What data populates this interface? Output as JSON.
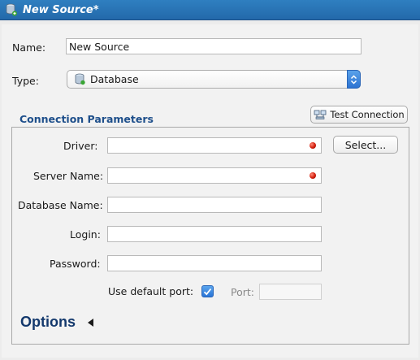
{
  "window": {
    "title": "New Source*",
    "icon": "database-icon"
  },
  "form": {
    "name_label": "Name:",
    "name_value": "New Source",
    "type_label": "Type:",
    "type_value": "Database",
    "type_icon": "database-icon"
  },
  "connection": {
    "section_title": "Connection Parameters",
    "test_button_label": "Test Connection",
    "test_button_icon": "connection-test-icon",
    "driver_label": "Driver:",
    "driver_value": "",
    "select_button_label": "Select...",
    "server_label": "Server Name:",
    "server_value": "",
    "database_label": "Database Name:",
    "database_value": "",
    "login_label": "Login:",
    "login_value": "",
    "password_label": "Password:",
    "password_value": "",
    "default_port_label": "Use default port:",
    "default_port_checked": true,
    "port_label": "Port:",
    "port_value": ""
  },
  "options": {
    "label": "Options"
  },
  "colors": {
    "titlebar": "#2369aa",
    "section_title": "#1e4f8b",
    "required_indicator": "#d11d0b",
    "accent": "#2c73d2"
  }
}
